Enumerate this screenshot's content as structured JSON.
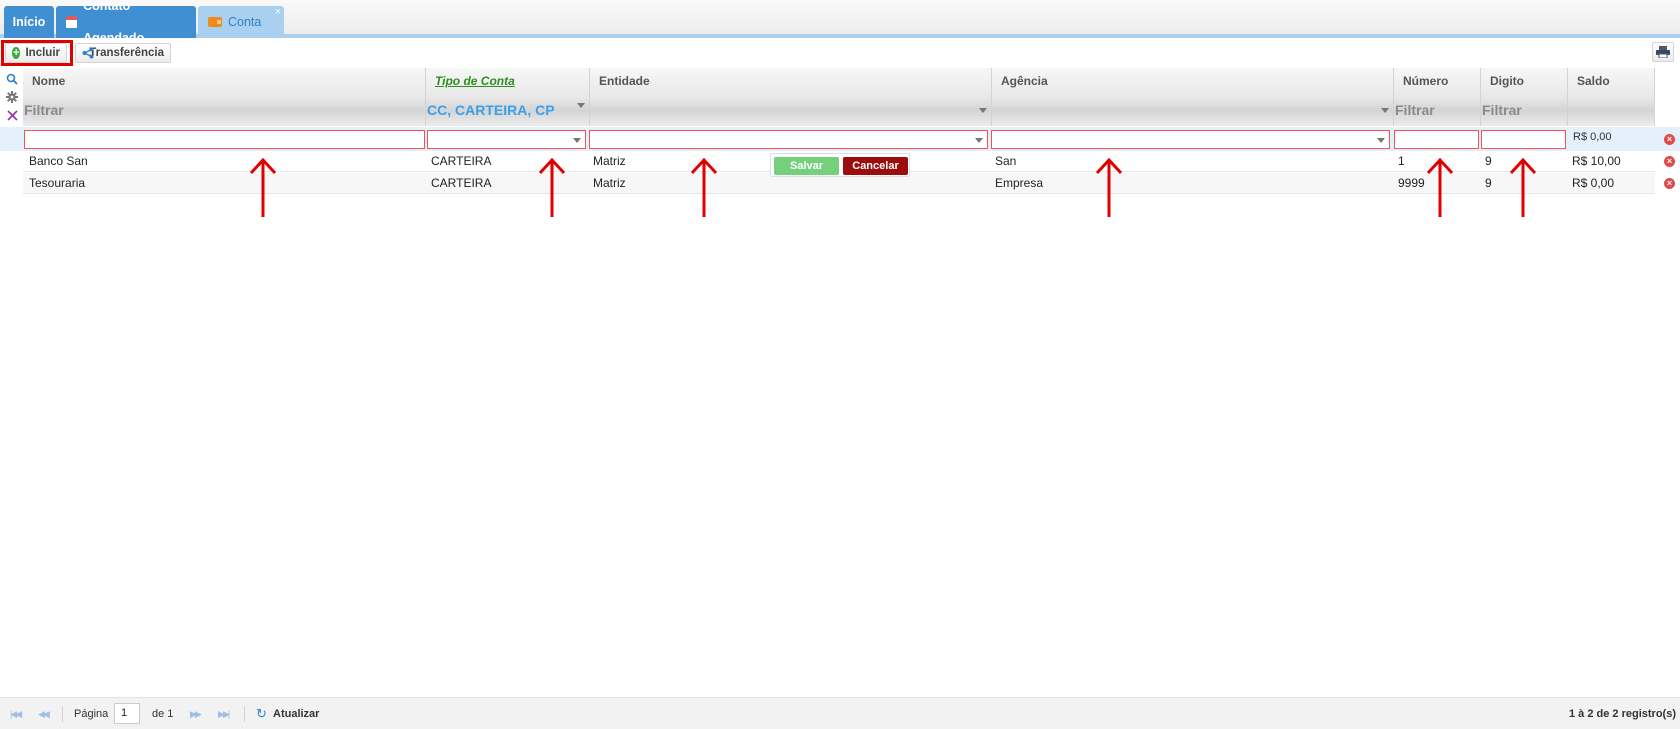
{
  "tabs": [
    {
      "label": "Início"
    },
    {
      "label": "Contato Agendado",
      "icon": "calendar-icon"
    },
    {
      "label": "Conta",
      "icon": "wallet-icon",
      "active": true,
      "close": "×"
    }
  ],
  "toolbar": {
    "incluir": "Incluir",
    "transferencia": "Transferência"
  },
  "columns": [
    "Nome",
    "Tipo de Conta",
    "Entidade",
    "Agência",
    "Número",
    "Digito",
    "Saldo"
  ],
  "filters": {
    "nome": "Filtrar",
    "tipo": "CC, CARTEIRA, CP",
    "entidade": "",
    "agencia": "",
    "numero": "Filtrar",
    "digito": "Filtrar"
  },
  "edit_row": {
    "saldo": "R$ 0,00"
  },
  "rows": [
    {
      "nome": "Banco San",
      "tipo": "CARTEIRA",
      "entidade": "Matriz",
      "agencia": "San",
      "numero": "1",
      "digito": "9",
      "saldo": "R$ 10,00"
    },
    {
      "nome": "Tesouraria",
      "tipo": "CARTEIRA",
      "entidade": "Matriz",
      "agencia": "Empresa",
      "numero": "9999",
      "digito": "9",
      "saldo": "R$ 0,00"
    }
  ],
  "edit_buttons": {
    "salvar": "Salvar",
    "cancelar": "Cancelar"
  },
  "pager": {
    "page_label": "Página",
    "page": "1",
    "of_label": "de 1",
    "refresh": "Atualizar",
    "summary": "1 à 2 de 2 registro(s)"
  },
  "colors": {
    "tab": "#3f8fd2",
    "tab_active": "#a9d0ef",
    "salvar": "#74d07a",
    "cancelar": "#9c0e0e",
    "annotation": "#e00000"
  }
}
